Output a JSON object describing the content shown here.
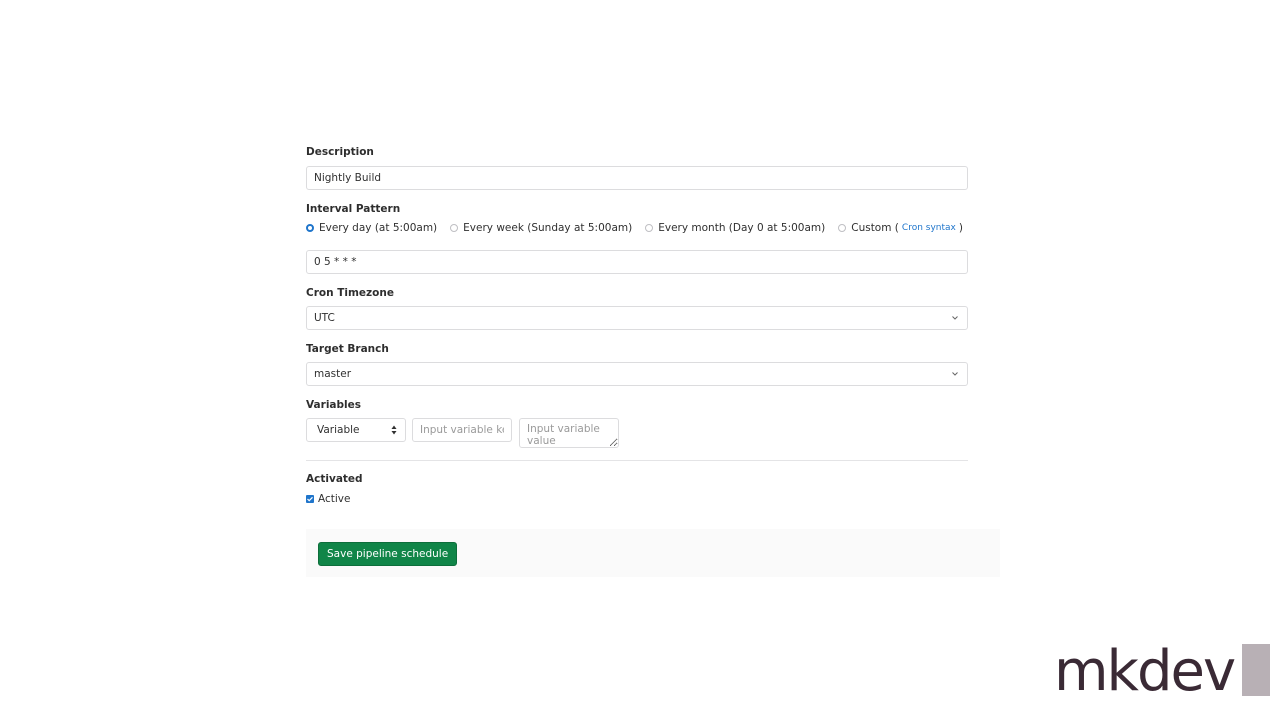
{
  "form": {
    "description_label": "Description",
    "description_value": "Nightly Build",
    "interval_label": "Interval Pattern",
    "interval_options": [
      {
        "label": "Every day (at 5:00am)",
        "checked": true
      },
      {
        "label": "Every week (Sunday at 5:00am)",
        "checked": false
      },
      {
        "label": "Every month (Day 0 at 5:00am)",
        "checked": false
      },
      {
        "label": "Custom (",
        "checked": false
      }
    ],
    "cron_syntax_link": "Cron syntax",
    "custom_close": ")",
    "cron_value": "0 5 * * *",
    "timezone_label": "Cron Timezone",
    "timezone_value": "UTC",
    "branch_label": "Target Branch",
    "branch_value": "master",
    "variables_label": "Variables",
    "variable_type": "Variable",
    "variable_key_placeholder": "Input variable key",
    "variable_value_placeholder": "Input variable value",
    "activated_label": "Activated",
    "active_label": "Active",
    "active_checked": true,
    "save_label": "Save pipeline schedule"
  },
  "brand": {
    "text": "mkdev"
  },
  "colors": {
    "primary": "#1f75cb",
    "confirm": "#108548",
    "brand": "#3a2a35"
  },
  "icons": {
    "select_chevron": "chevron-down-icon",
    "select_updown": "sort-icon",
    "checkbox_check": "check-icon"
  }
}
